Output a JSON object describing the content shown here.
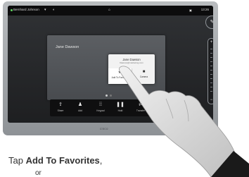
{
  "topbar": {
    "user_name": "Bernhard Johnson",
    "time": "13:26"
  },
  "main_window": {
    "participant_name": "Jane Dawson"
  },
  "contact_card": {
    "name": "Jane Dawson",
    "address": "Dawson@marketing.com",
    "add_to_favorites_label": "Add To Favorites",
    "camera_label": "Camera"
  },
  "call_bar": {
    "items": [
      {
        "label": "Share",
        "icon": "share-icon"
      },
      {
        "label": "Add",
        "icon": "add-participant-icon"
      },
      {
        "label": "Keypad",
        "icon": "keypad-icon"
      },
      {
        "label": "Hold",
        "icon": "hold-icon"
      },
      {
        "label": "Transfer",
        "icon": "transfer-icon"
      }
    ]
  },
  "device": {
    "brand": "cisco"
  },
  "caption": {
    "prefix": "Tap ",
    "emphasis": "Add To Favorites",
    "suffix": ",",
    "line2": "or"
  },
  "colors": {
    "end_call": "#d9372d",
    "status_online": "#5fd35f"
  }
}
